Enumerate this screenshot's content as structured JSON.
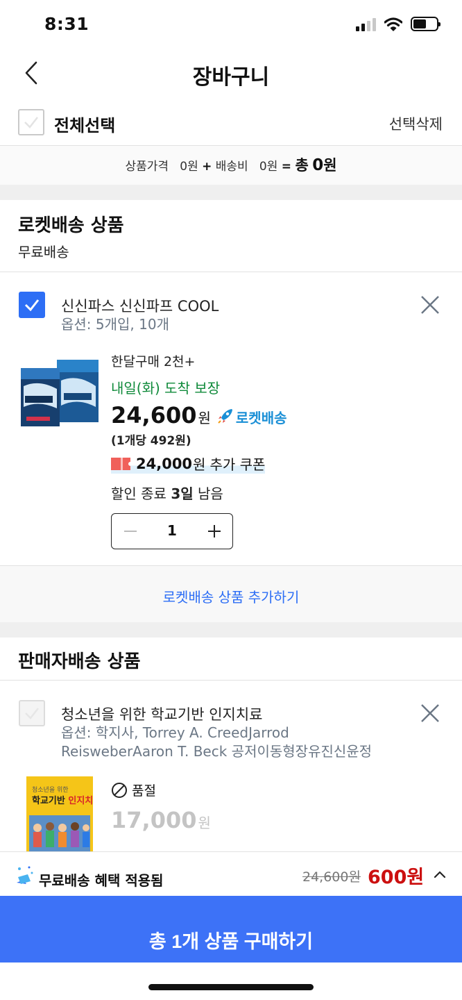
{
  "status_bar": {
    "time": "8:31"
  },
  "header": {
    "title": "장바구니"
  },
  "select_bar": {
    "select_all_label": "전체선택",
    "delete_selected_label": "선택삭제"
  },
  "summary": {
    "product_price_label": "상품가격",
    "product_price": "0원",
    "plus": "+",
    "shipping_label": "배송비",
    "shipping_price": "0원",
    "equals": "=",
    "total_label": "총",
    "total_value": "0",
    "won": "원"
  },
  "rocket_section": {
    "title": "로켓배송 상품",
    "subtitle": "무료배송",
    "item": {
      "checked": true,
      "name": "신신파스 신신파프 COOL",
      "option": "옵션: 5개입, 10개",
      "monthly_purchase": "한달구매 2천+",
      "arrival": "내일(화) 도착 보장",
      "price": "24,600",
      "price_unit": "원",
      "rocket_badge": "로켓배송",
      "unit_price": "(1개당 492원)",
      "coupon_amount": "24,000",
      "coupon_won": "원",
      "coupon_text": "추가 쿠폰",
      "discount_prefix": "할인 종료",
      "discount_days": "3일",
      "discount_suffix": "남음",
      "quantity": "1"
    },
    "add_more_label": "로켓배송 상품 추가하기"
  },
  "seller_section": {
    "title": "판매자배송 상품",
    "item": {
      "checked": false,
      "name": "청소년을 위한 학교기반 인지치료",
      "option": "옵션: 학지사, Torrey A. CreedJarrod ReisweberAaron T. Beck 공저이동형장유진신윤정",
      "status": "품절",
      "price": "17,000",
      "price_unit": "원",
      "book_title_top": "청소년을 위한",
      "book_title_main": "학교기반",
      "book_title_accent": "인지치료"
    }
  },
  "bottom_bar": {
    "benefit_label": "무료배송 혜택 적용됨",
    "original_price": "24,600원",
    "final_price": "600원"
  },
  "buy_button": {
    "label": "총 1개 상품 구매하기"
  },
  "colors": {
    "accent": "#3d72f7",
    "arrival_green": "#0f8a3a",
    "sale_red": "#cc1010",
    "rocket_blue": "#1a8fd6"
  }
}
